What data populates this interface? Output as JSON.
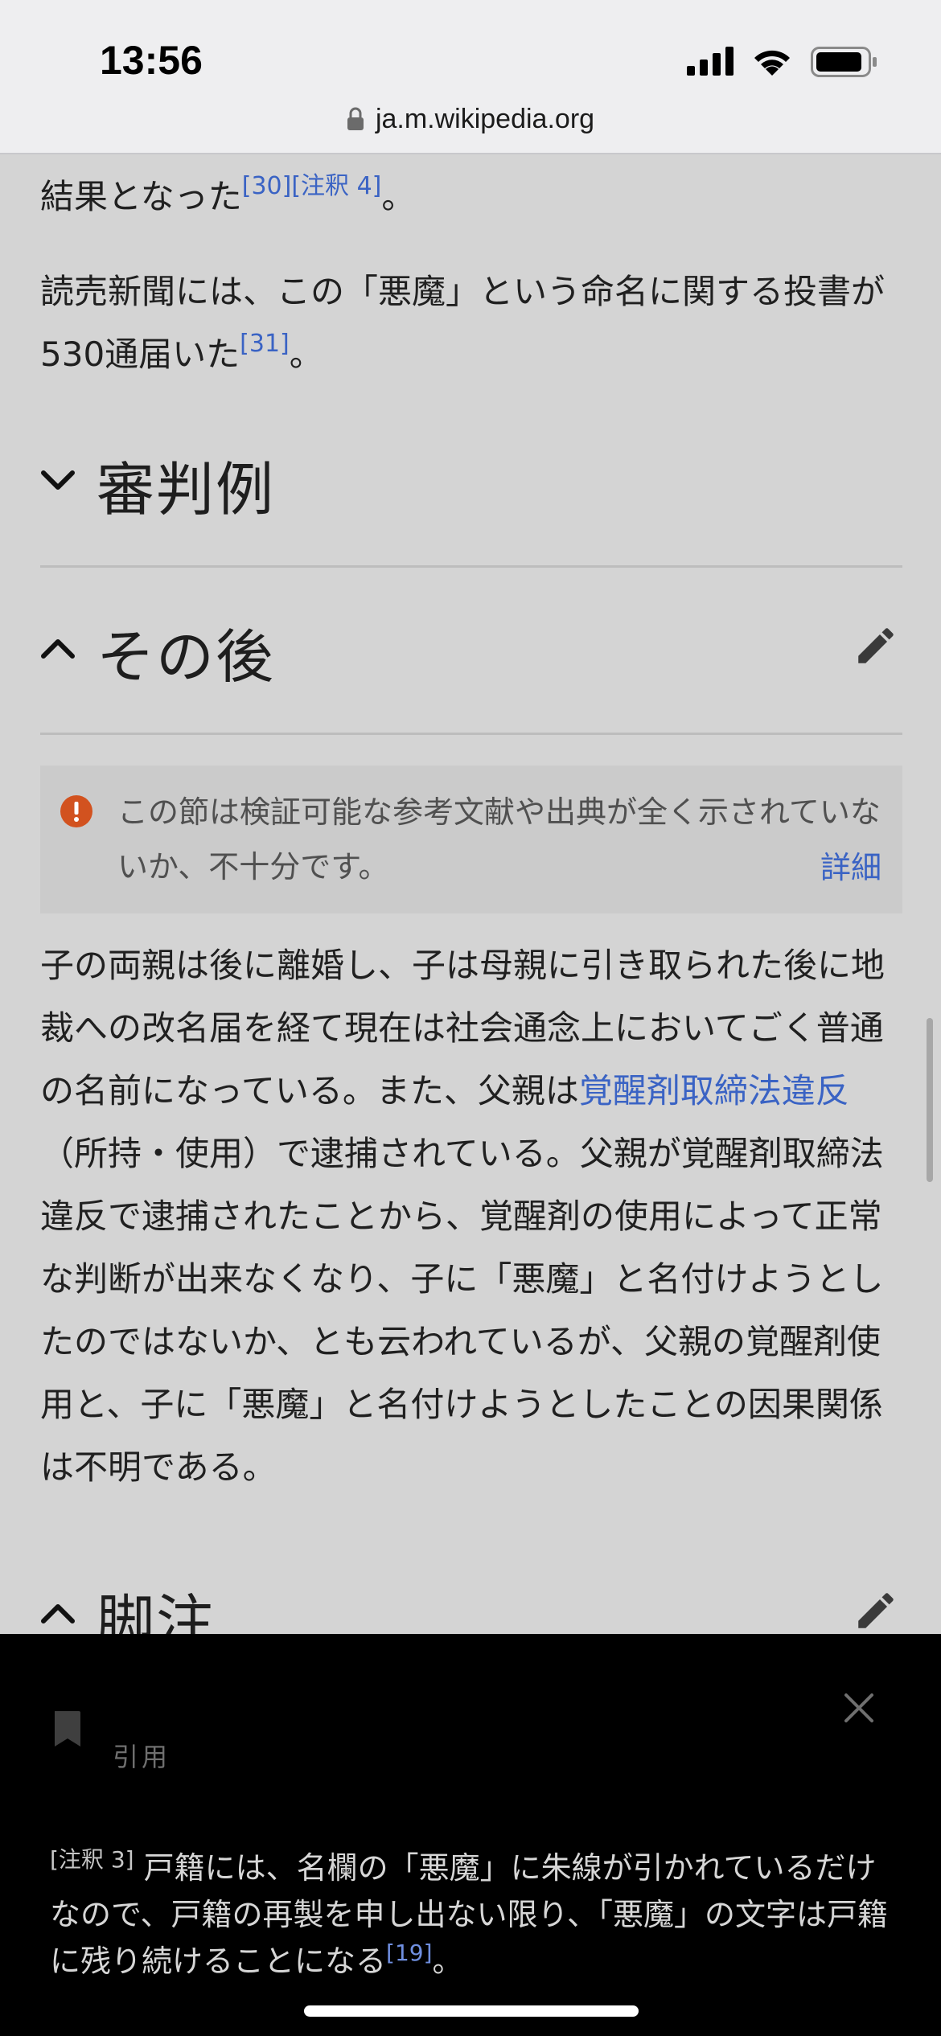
{
  "status_bar": {
    "time": "13:56"
  },
  "url": "ja.m.wikipedia.org",
  "content": {
    "para0_text": "結果となった",
    "para0_ref1": "[30]",
    "para0_ref2": "[注釈 4]",
    "para0_end": "。",
    "para1_text": "読売新聞には、この「悪魔」という命名に関する投書が530通届いた",
    "para1_ref": "[31]",
    "para1_end": "。",
    "section1_title": "審判例",
    "section2_title": "その後",
    "ambox_text": "この節は検証可能な参考文献や出典が全く示されていないか、不十分です。",
    "ambox_more": "詳細",
    "para2_part1": "子の両親は後に離婚し、子は母親に引き取られた後に地裁への改名届を経て現在は社会通念上においてごく普通の名前になっている。また、父親は",
    "para2_link": "覚醒剤取締法違反",
    "para2_part2": "（所持・使用）で逮捕されている。父親が覚醒剤取締法違反で逮捕されたことから、覚醒剤の使用によって正常な判断が出来なくなり、子に「悪魔」と名付けようとしたのではないか、とも云われているが、父親の覚醒剤使用と、子に「悪魔」と名付けようとしたことの因果関係は不明である。",
    "section3_title": "脚注"
  },
  "drawer": {
    "label": "引用",
    "note_mark": "[注釈 3]",
    "note_text": " 戸籍には、名欄の「悪魔」に朱線が引かれているだけなので、戸籍の再製を申し出ない限り、「悪魔」の文字は戸籍に残り続けることになる",
    "note_ref": "[19]",
    "note_end": "。"
  },
  "icons": {
    "lock": "lock-icon",
    "chevron_down": "chevron-down-icon",
    "chevron_up": "chevron-up-icon",
    "pencil": "pencil-icon",
    "warning": "warning-icon",
    "book": "bookmark-icon",
    "close": "close-icon"
  },
  "colors": {
    "link": "#3a63c4",
    "warning": "#d2521f",
    "drawer_bg": "#000000"
  }
}
